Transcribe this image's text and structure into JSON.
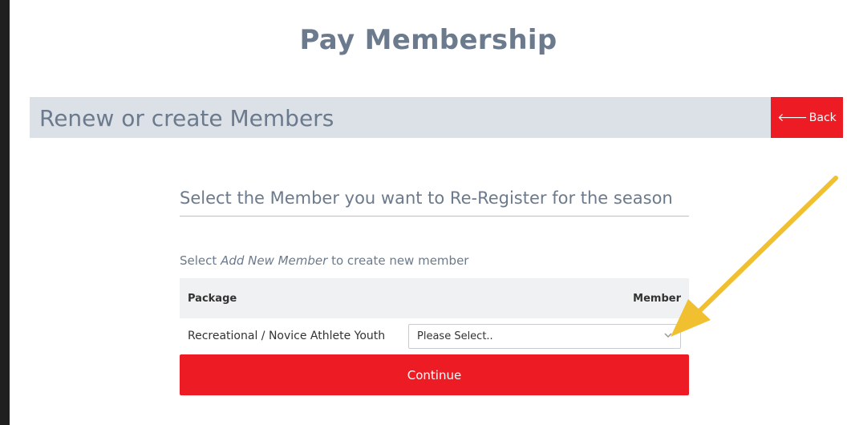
{
  "page": {
    "title": "Pay Membership"
  },
  "section": {
    "title": "Renew or create Members",
    "back_arrow": "🡐",
    "back_label": "Back"
  },
  "form": {
    "subtitle": "Select the Member you want to Re-Register for the season",
    "hint_prefix": "Select",
    "hint_emphasis": "Add New Member",
    "hint_suffix": "to create new member",
    "table": {
      "col_package": "Package",
      "col_member": "Member",
      "rows": [
        {
          "package": "Recreational / Novice Athlete Youth",
          "member_value": "Please Select.."
        }
      ]
    },
    "continue_label": "Continue"
  },
  "colors": {
    "accent": "#ed1c24",
    "annotation_arrow": "#f0c030"
  }
}
